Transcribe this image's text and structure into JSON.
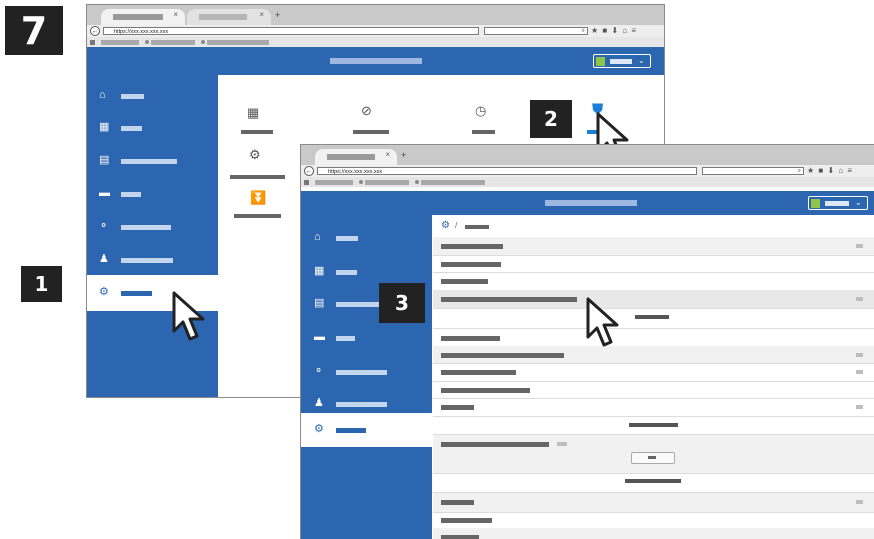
{
  "step_main": "7",
  "callouts": [
    "1",
    "2",
    "3"
  ],
  "browser": {
    "url": "https://xxx.xxx.xxx.xxx",
    "search_icon": "magnifier-icon",
    "toolbar_icons": "★ ■ ⬇ ⌂ ≡",
    "new_tab": "+",
    "close_tab": "×",
    "back": "←"
  },
  "sidebar_icons": [
    "home-icon",
    "dashboard-icon",
    "address-book-icon",
    "tray-icon",
    "network-icon",
    "user-lock-icon",
    "gear-icon"
  ],
  "sidebar_glyphs": [
    "⌂",
    "▦",
    "▤",
    "▬",
    "⚬",
    "♟",
    "⚙"
  ],
  "settings_grid_icons": [
    "calendar-icon",
    "refresh-icon",
    "timer-icon",
    "shield-icon",
    "gears-icon",
    "double-chevron-icon"
  ],
  "breadcrumb": {
    "icon": "gear-icon",
    "separator": "/"
  },
  "colors": {
    "brand": "#2d66b0",
    "header": "#2d66b0",
    "active_icon": "#1a7fd6",
    "avatar": "#8fc64a",
    "callout_bg": "#222222"
  }
}
